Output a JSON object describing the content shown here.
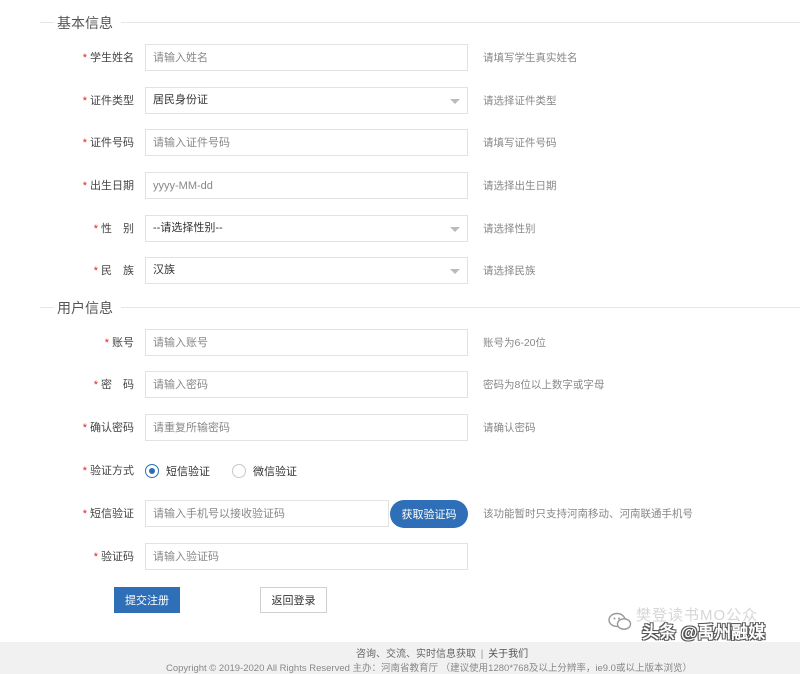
{
  "sections": {
    "basic": "基本信息",
    "user": "用户信息"
  },
  "fields": {
    "student_name": {
      "label": "学生姓名",
      "placeholder": "请输入姓名",
      "hint": "请填写学生真实姓名"
    },
    "id_type": {
      "label": "证件类型",
      "value": "居民身份证",
      "hint": "请选择证件类型"
    },
    "id_number": {
      "label": "证件号码",
      "placeholder": "请输入证件号码",
      "hint": "请填写证件号码"
    },
    "birth_date": {
      "label": "出生日期",
      "placeholder": "yyyy-MM-dd",
      "hint": "请选择出生日期"
    },
    "gender": {
      "label": "性　别",
      "value": "--请选择性别--",
      "hint": "请选择性别"
    },
    "ethnicity": {
      "label": "民　族",
      "value": "汉族",
      "hint": "请选择民族"
    },
    "account": {
      "label": "账号",
      "placeholder": "请输入账号",
      "hint": "账号为6-20位"
    },
    "password": {
      "label": "密　码",
      "placeholder": "请输入密码",
      "hint": "密码为8位以上数字或字母"
    },
    "confirm_password": {
      "label": "确认密码",
      "placeholder": "请重复所输密码",
      "hint": "请确认密码"
    },
    "verify_method": {
      "label": "验证方式",
      "options": [
        "短信验证",
        "微信验证"
      ],
      "selected": "短信验证"
    },
    "sms_verify": {
      "label": "短信验证",
      "placeholder": "请输入手机号以接收验证码",
      "button": "获取验证码",
      "hint": "该功能暂时只支持河南移动、河南联通手机号"
    },
    "verify_code": {
      "label": "验证码",
      "placeholder": "请输入验证码"
    }
  },
  "required_mark": "*",
  "buttons": {
    "submit": "提交注册",
    "back": "返回登录"
  },
  "footer": {
    "links_text": "咨询、交流、实时信息获取",
    "separator": "|",
    "about": "关于我们",
    "copyright": "Copyright © 2019-2020 All Rights Reserved 主办：河南省教育厅 （建议使用1280*768及以上分辨率，ie9.0或以上版本浏览）"
  },
  "watermark": {
    "line1": "樊登读书MO公众",
    "line2": "头条 @禹州融媒"
  },
  "colors": {
    "accent": "#2f6fb7",
    "required": "#e2231a",
    "border": "#e2e2e2"
  }
}
